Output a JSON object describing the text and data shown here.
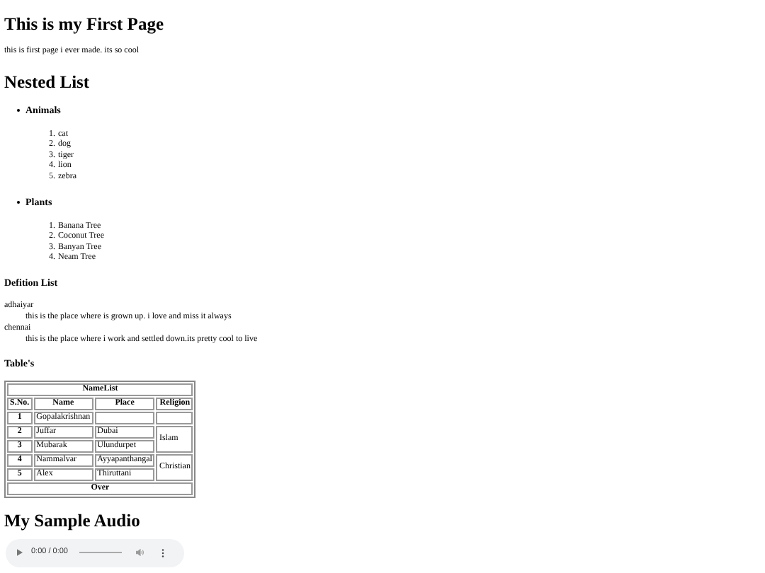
{
  "title": "This is my First Page",
  "intro": "this is first page i ever made. its so cool",
  "nested_list": {
    "heading": "Nested List",
    "groups": [
      {
        "label": "Animals",
        "items": [
          {
            "number": "1.",
            "text": "cat"
          },
          {
            "number": "2.",
            "text": "dog"
          },
          {
            "number": "3.",
            "text": "tiger"
          },
          {
            "number": "4.",
            "text": "lion"
          },
          {
            "number": "5.",
            "text": "zebra"
          }
        ]
      },
      {
        "label": "Plants",
        "items": [
          {
            "number": "1.",
            "text": "Banana Tree"
          },
          {
            "number": "2.",
            "text": "Coconut Tree"
          },
          {
            "number": "3.",
            "text": "Banyan Tree"
          },
          {
            "number": "4.",
            "text": "Neam Tree"
          }
        ]
      }
    ]
  },
  "definition_list": {
    "heading": "Defition List",
    "entries": [
      {
        "term": "adhaiyar",
        "definition": "this is the place where is grown up. i love and miss it always"
      },
      {
        "term": "chennai",
        "definition": "this is the place where i work and settled down.its pretty cool to live"
      }
    ]
  },
  "table_section": {
    "heading": "Table's",
    "table": {
      "caption": "NameList",
      "columns": [
        "S.No.",
        "Name",
        "Place",
        "Religion"
      ],
      "groups": [
        {
          "rows": [
            {
              "sno": "1",
              "name": "Gopalakrishnan"
            }
          ]
        },
        {
          "religion": "Islam",
          "rows": [
            {
              "sno": "2",
              "name": "Juffar",
              "place": "Dubai"
            },
            {
              "sno": "3",
              "name": "Mubarak",
              "place": "Ulundurpet"
            }
          ]
        },
        {
          "religion": "Christian",
          "rows": [
            {
              "sno": "4",
              "name": "Nammalvar",
              "place": "Ayyapanthangal"
            },
            {
              "sno": "5",
              "name": "Alex",
              "place": "Thiruttani"
            }
          ]
        }
      ],
      "footer": "Over"
    }
  },
  "audio_section": {
    "heading": "My Sample Audio",
    "player": {
      "time": "0:00 / 0:00"
    }
  }
}
